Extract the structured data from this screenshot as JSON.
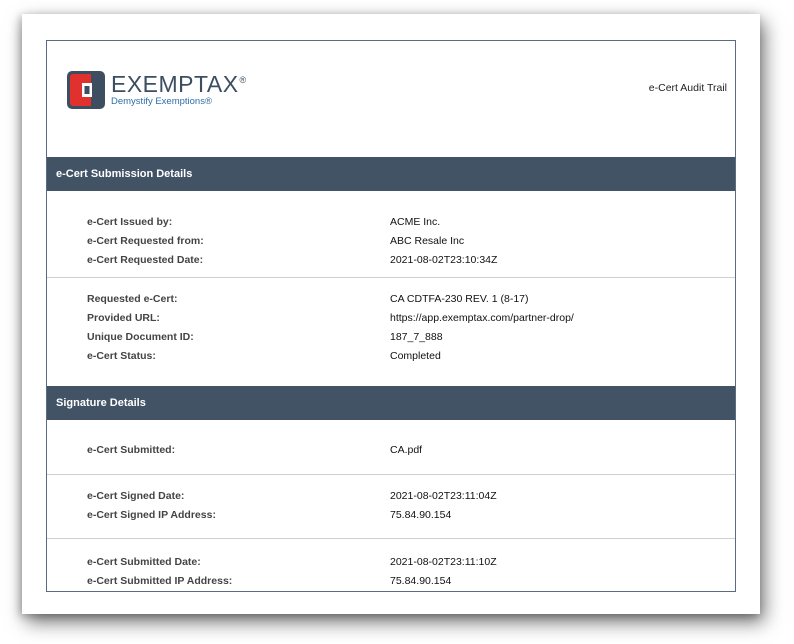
{
  "brand": {
    "name": "EXEMPTAX",
    "mark": "®",
    "tagline": "Demystify Exemptions®"
  },
  "doc_title": "e-Cert Audit Trail",
  "sections": [
    {
      "title": "e-Cert Submission Details",
      "groups": [
        {
          "rows": [
            {
              "label": "e-Cert Issued by:",
              "value": "ACME Inc."
            },
            {
              "label": "e-Cert Requested from:",
              "value": "ABC Resale Inc"
            },
            {
              "label": "e-Cert Requested Date:",
              "value": "2021-08-02T23:10:34Z"
            }
          ]
        },
        {
          "rows": [
            {
              "label": "Requested e-Cert:",
              "value": "CA CDTFA-230 REV. 1 (8-17)"
            },
            {
              "label": "Provided URL:",
              "value": "https://app.exemptax.com/partner-drop/"
            },
            {
              "label": "Unique Document ID:",
              "value": "187_7_888"
            },
            {
              "label": "e-Cert Status:",
              "value": "Completed"
            }
          ]
        }
      ]
    },
    {
      "title": "Signature Details",
      "groups": [
        {
          "rows": [
            {
              "label": "e-Cert Submitted:",
              "value": "CA.pdf"
            }
          ]
        },
        {
          "rows": [
            {
              "label": "e-Cert Signed Date:",
              "value": "2021-08-02T23:11:04Z"
            },
            {
              "label": "e-Cert Signed IP Address:",
              "value": "75.84.90.154"
            }
          ]
        },
        {
          "rows": [
            {
              "label": "e-Cert Submitted Date:",
              "value": "2021-08-02T23:11:10Z"
            },
            {
              "label": "e-Cert Submitted IP Address:",
              "value": "75.84.90.154"
            }
          ]
        }
      ]
    }
  ],
  "colors": {
    "header_bar": "#435366",
    "logo_red": "#e0312e",
    "logo_dark": "#3d4e61",
    "tagline": "#2e6ea8"
  }
}
